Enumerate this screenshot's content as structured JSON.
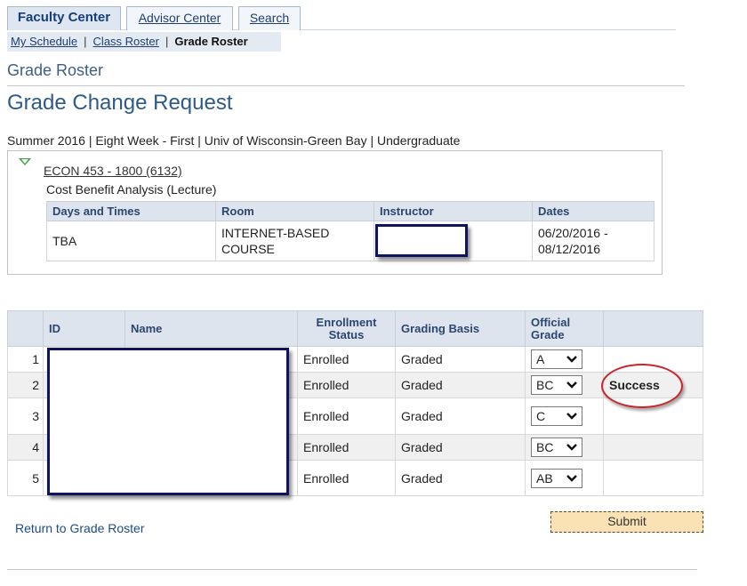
{
  "tabs": [
    {
      "label": "Faculty Center",
      "active": true
    },
    {
      "label": "Advisor Center",
      "active": false
    },
    {
      "label": "Search",
      "active": false
    }
  ],
  "subnav": {
    "my_schedule": "My Schedule",
    "class_roster": "Class Roster",
    "grade_roster": "Grade Roster",
    "separator": "|"
  },
  "page_title": "Grade Roster",
  "sub_title": "Grade Change Request",
  "term_line": "Summer 2016 | Eight Week - First | Univ of Wisconsin-Green Bay | Undergraduate",
  "course": {
    "link": "ECON 453 - 1800 (6132)",
    "description": "Cost Benefit Analysis (Lecture)",
    "meeting_headers": [
      "Days and Times",
      "Room",
      "Instructor",
      "Dates"
    ],
    "meeting": {
      "days_times": "TBA",
      "room_line1": "INTERNET-BASED",
      "room_line2": "COURSE",
      "instructor": "",
      "dates_line1": "06/20/2016 -",
      "dates_line2": "08/12/2016"
    }
  },
  "roster": {
    "headers": {
      "id": "ID",
      "name": "Name",
      "enrollment_1": "Enrollment",
      "enrollment_2": "Status",
      "grading_basis": "Grading Basis",
      "official_1": "Official",
      "official_2": "Grade"
    },
    "rows": [
      {
        "n": "1",
        "status": "Enrolled",
        "basis": "Graded",
        "grade": "A",
        "message": ""
      },
      {
        "n": "2",
        "status": "Enrolled",
        "basis": "Graded",
        "grade": "BC",
        "message": "Success"
      },
      {
        "n": "3",
        "status": "Enrolled",
        "basis": "Graded",
        "grade": "C",
        "message": ""
      },
      {
        "n": "4",
        "status": "Enrolled",
        "basis": "Graded",
        "grade": "BC",
        "message": ""
      },
      {
        "n": "5",
        "status": "Enrolled",
        "basis": "Graded",
        "grade": "AB",
        "message": ""
      }
    ]
  },
  "submit_label": "Submit",
  "return_link": "Return to Grade Roster",
  "colors": {
    "accent_blue": "#2d5a88",
    "submit_bg": "#fbe2b5",
    "highlight_red": "#c9252b",
    "expand_green": "#3f9d3f"
  },
  "icons": {
    "expand": "triangle-down-icon",
    "dropdown": "chevron-down-icon"
  }
}
